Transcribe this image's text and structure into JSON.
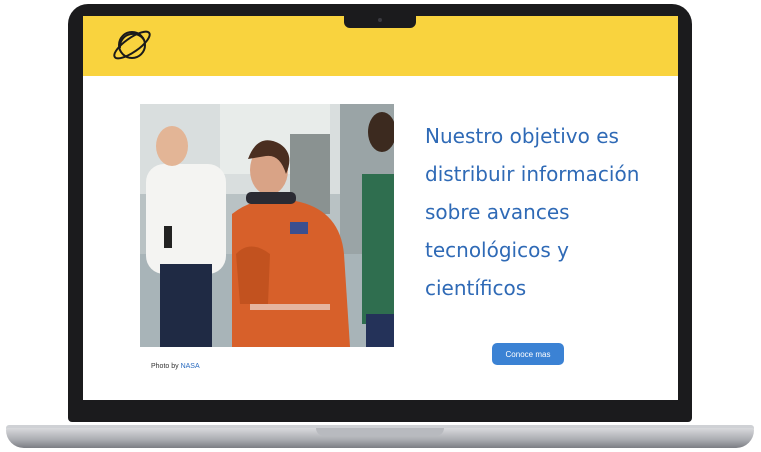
{
  "site": {
    "logo_icon": "planet-icon",
    "header_color": "#f9d33e",
    "accent_color": "#2f6ab6",
    "button_color": "#3b82d4"
  },
  "hero": {
    "headline": "Nuestro objetivo es distribuir información sobre avances tecnológicos y científicos",
    "cta_label": "Conoce mas",
    "photo_credit_prefix": "Photo by ",
    "photo_credit_link": "NASA"
  }
}
